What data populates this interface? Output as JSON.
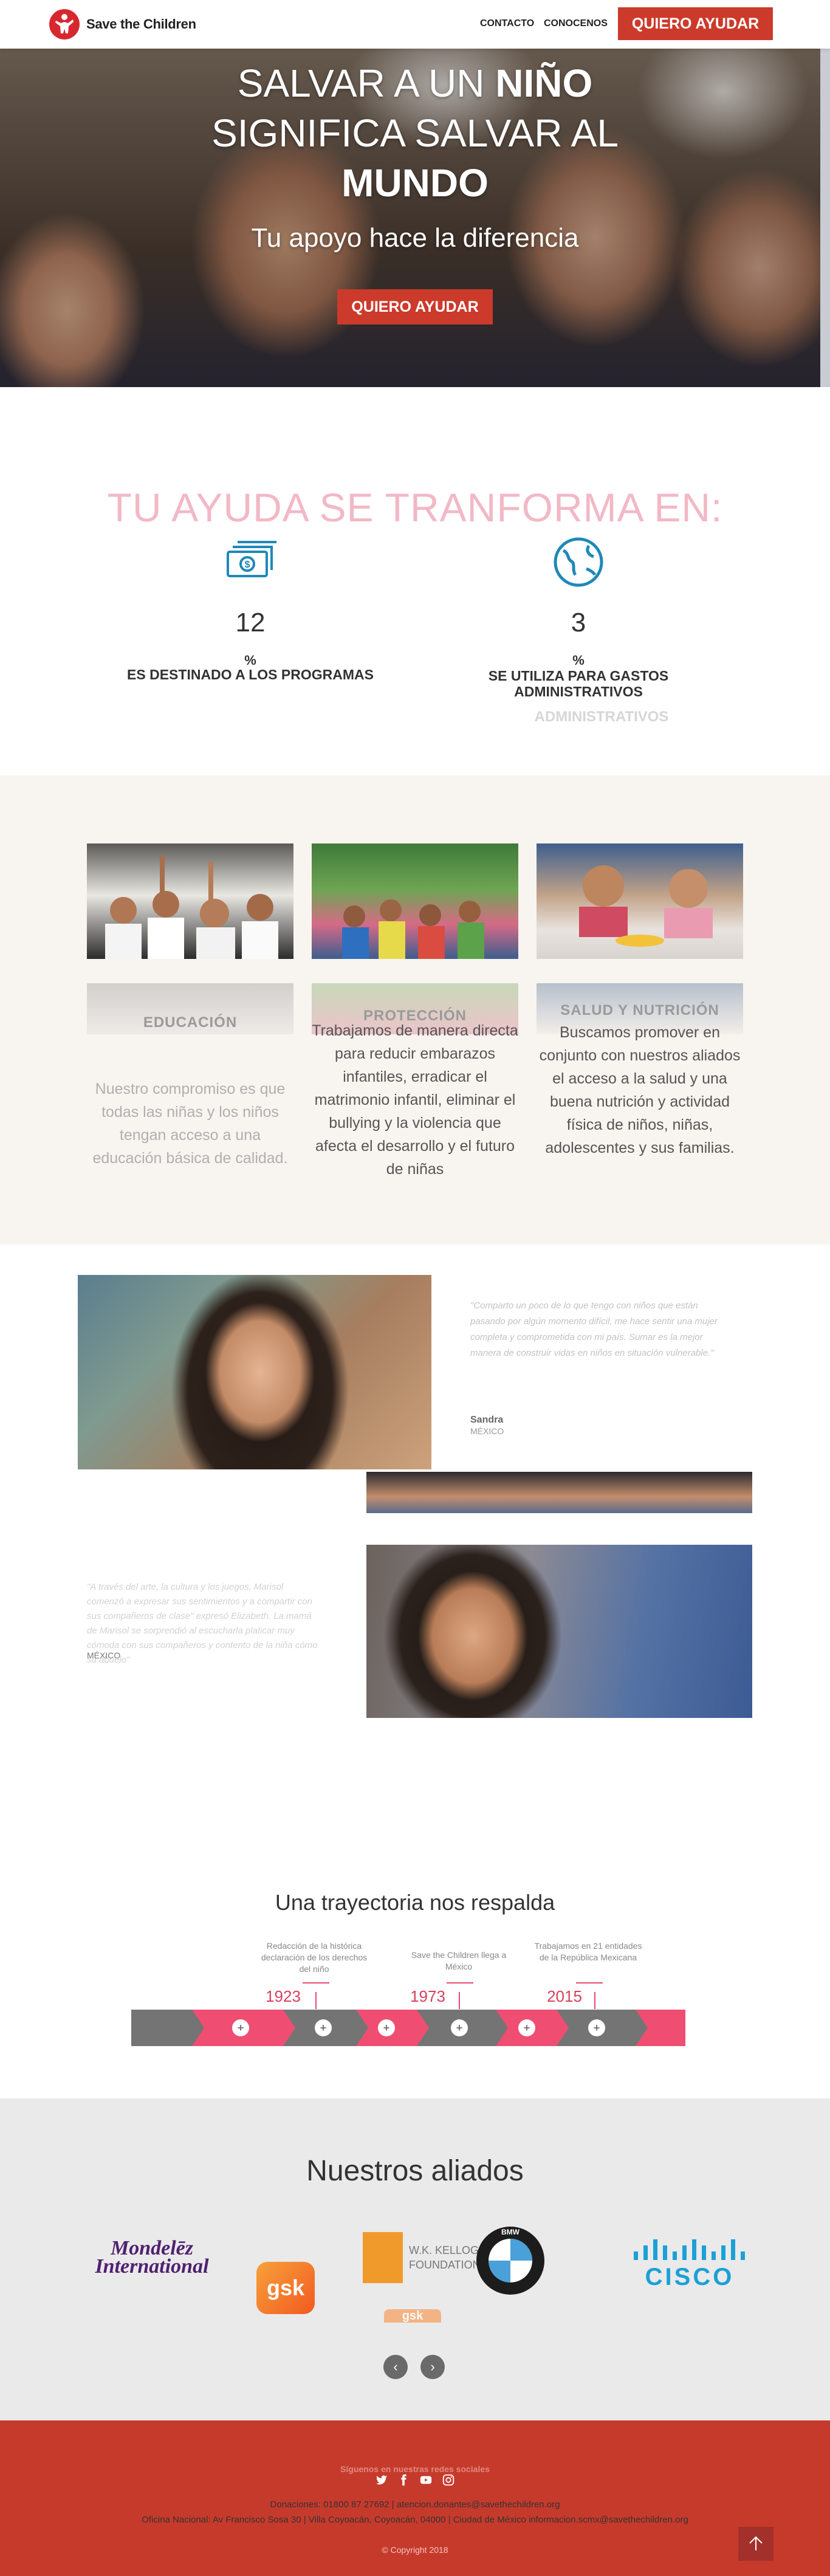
{
  "header": {
    "logo_text": "Save the Children",
    "nav": {
      "contacto": "CONTACTO",
      "conocenos": "CONOCENOS"
    },
    "cta": "QUIERO AYUDAR"
  },
  "hero": {
    "title_line1_pre": "SALVAR A UN ",
    "title_line1_bold": "NIÑO",
    "title_line2": "SIGNIFICA SALVAR AL",
    "title_line3_bold": "MUNDO",
    "subtitle": "Tu apoyo hace la diferencia",
    "cta": "QUIERO AYUDAR"
  },
  "impact": {
    "title": "TU AYUDA SE TRANFORMA EN:",
    "items": [
      {
        "icon": "money-icon",
        "number": "12",
        "unit": "%",
        "label": "ES DESTINADO A LOS PROGRAMAS"
      },
      {
        "icon": "globe-icon",
        "number": "3",
        "unit": "%",
        "label": "SE UTILIZA PARA GASTOS ADMINISTRATIVOS",
        "ghost": "ADMINISTRATIVOS"
      }
    ]
  },
  "programs": [
    {
      "name": "EDUCACIÓN",
      "text": "Nuestro compromiso es que todas las niñas y los niños tengan acceso a una educación básica de calidad."
    },
    {
      "name": "PROTECCIÓN",
      "text": "Trabajamos de manera directa para reducir embarazos infantiles, erradicar el matrimonio infantil, eliminar el bullying y la violencia que afecta el desarrollo y el futuro de niñas"
    },
    {
      "name": "SALUD Y NUTRICIÓN",
      "text": "Buscamos promover en conjunto con nuestros aliados el acceso a la salud y una buena nutrición y actividad física de niños, niñas, adolescentes y sus familias."
    }
  ],
  "testimonials": [
    {
      "quote": "\"Comparto un poco de lo que tengo con niños que están pasando por algún momento difícil, me hace sentir una mujer completa y comprometida con mi país. Sumar es la mejor manera de construir vidas en niños en situación vulnerable.\"",
      "name": "Sandra",
      "place": "MÉXICO"
    },
    {
      "quote": "\"A través del arte, la cultura y los juegos, Marisol comenzó a expresar sus sentimientos y a compartir con sus compañeros de clase\" expresó Elizabeth. La mamá de Marisol se sorprendió al escucharla platicar muy cómoda con sus compañeros y contento de la niña cómo su abuelo\"",
      "place": "MÉXICO"
    }
  ],
  "timeline": {
    "title": "Una trayectoria nos respalda",
    "events": [
      {
        "desc": "Redacción de la histórica declaración de los derechos del niño",
        "year": "1923"
      },
      {
        "desc": "Save the Children llega a México",
        "year": "1973"
      },
      {
        "desc": "Trabajamos en 21 entidades de la República Mexicana",
        "year": "2015"
      }
    ],
    "dot_symbol": "+"
  },
  "partners": {
    "title": "Nuestros aliados",
    "logos": [
      "Mondelēz International",
      "gsk",
      "W.K. KELLOGG FOUNDATION",
      "BMW",
      "CISCO"
    ],
    "ghost_logo": "gsk",
    "prev": "‹",
    "next": "›"
  },
  "footer": {
    "follow": "Síguenos en nuestras redes sociales",
    "social": [
      "twitter-icon",
      "facebook-icon",
      "youtube-icon",
      "instagram-icon"
    ],
    "donations": "Donaciones: 01800 87 27692 | atencion.donantes@savethechildren.org",
    "office": "Oficina Nacional: Av Francisco Sosa 30 | Villa Coyoacán, Coyoacán, 04000 | Ciudad de México informacion.scmx@savethechildren.org",
    "copyright": "© Copyright 2018"
  },
  "colors": {
    "brand_red": "#cc3a2b",
    "pink": "#ef4e72",
    "icon_blue": "#1f88b8"
  }
}
